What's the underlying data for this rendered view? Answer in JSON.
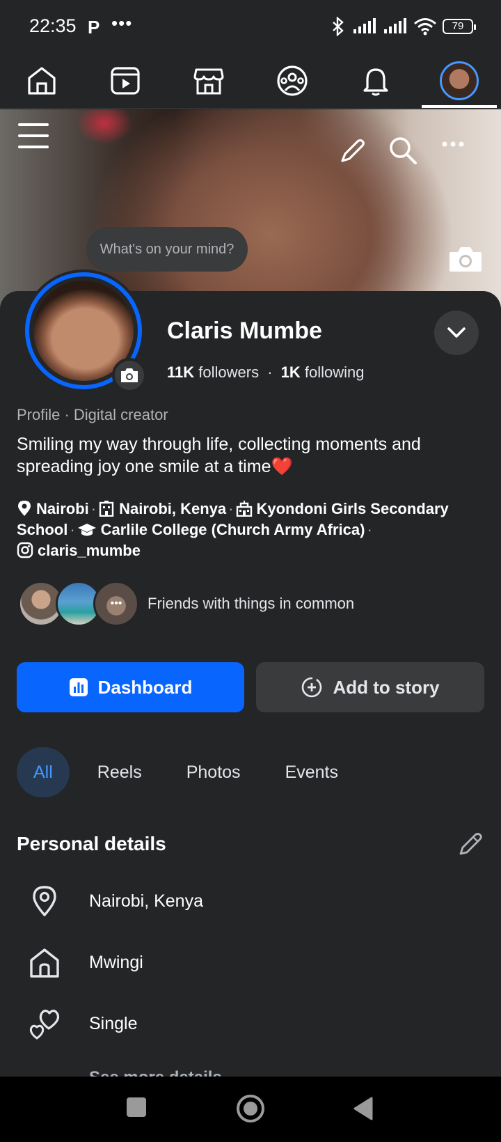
{
  "status_bar": {
    "time": "22:35",
    "p_label": "P",
    "more": "•••",
    "battery": "79"
  },
  "top_nav": {
    "items": [
      "home",
      "video",
      "marketplace",
      "groups",
      "notifications",
      "profile"
    ]
  },
  "cover": {
    "thought_prompt": "What's on your mind?"
  },
  "profile": {
    "name": "Claris Mumbe",
    "followers_count": "11K",
    "followers_label": "followers",
    "following_count": "1K",
    "following_label": "following",
    "stats_sep": "·",
    "category": "Profile · Digital creator",
    "bio": "Smiling my way through life, collecting moments and spreading joy one smile at a time❤️"
  },
  "info": {
    "current_city": "Nairobi",
    "hometown": "Nairobi, Kenya",
    "school": "Kyondoni Girls Secondary School",
    "college": "Carlile College (Church Army Africa)",
    "instagram": "claris_mumbe",
    "sep": "·"
  },
  "friends": {
    "text": "Friends with things in common",
    "more_dots": "•••"
  },
  "actions": {
    "dashboard": "Dashboard",
    "add_story": "Add to story"
  },
  "tabs": [
    {
      "label": "All",
      "active": true
    },
    {
      "label": "Reels",
      "active": false
    },
    {
      "label": "Photos",
      "active": false
    },
    {
      "label": "Events",
      "active": false
    }
  ],
  "personal_details": {
    "title": "Personal details",
    "rows": [
      {
        "icon": "location-icon",
        "text": "Nairobi, Kenya"
      },
      {
        "icon": "home-icon",
        "text": "Mwingi"
      },
      {
        "icon": "hearts-icon",
        "text": "Single"
      }
    ],
    "see_more": "See more details"
  },
  "colors": {
    "accent": "#0866ff",
    "background": "#242526",
    "button_secondary": "#3a3b3c",
    "tab_active_bg": "#263951",
    "tab_active_text": "#4599ff"
  }
}
